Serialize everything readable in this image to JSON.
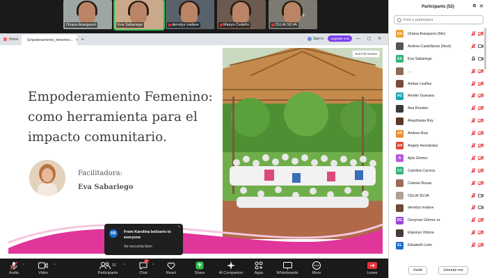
{
  "gallery": {
    "tiles": [
      {
        "name": "Oriana Aranguren",
        "muted": false,
        "active": false,
        "bg": "#9da6a3"
      },
      {
        "name": "Eva Sabariego",
        "muted": false,
        "active": true,
        "bg": "#caa98b"
      },
      {
        "name": "derrelys malave",
        "muted": true,
        "active": false,
        "bg": "#59626b"
      },
      {
        "name": "Mairyn Cedeño",
        "muted": true,
        "active": false,
        "bg": "#6c5a50"
      },
      {
        "name": "CELIA SILVA",
        "muted": true,
        "active": false,
        "bg": "#7d7a72"
      }
    ],
    "next_arrow": "›"
  },
  "browser": {
    "tab_home": "Home",
    "tab_current": "Empoderamiento_femenino...",
    "sign_in": "Sign in",
    "upgrade": "Upgrade now",
    "window_controls": "— ▢ ✕"
  },
  "slide": {
    "title": "Empoderamiento Femenino: como herramienta para el impacto comunitario.",
    "facilitator_label": "Facilitadora:",
    "facilitator_name": "Eva Sabariego",
    "exit_fullscreen": "Exit Full Screen"
  },
  "notification": {
    "initials": "KB",
    "title": "From Karolina belizario to everyone",
    "message": "Se escucha bien",
    "close": "×"
  },
  "toolbar": {
    "audio": "Audio",
    "video": "Video",
    "participants": "Participants",
    "participants_count": "52",
    "chat": "Chat",
    "chat_badge": "1",
    "react": "React",
    "share": "Share",
    "ai_companion": "AI Companion",
    "apps": "Apps",
    "whiteboards": "Whiteboards",
    "more": "More",
    "leave": "Leave",
    "caret": "^",
    "accent_green": "#2fbf4f",
    "leave_red": "#e0333a"
  },
  "panel": {
    "title": "Participants (52)",
    "search_placeholder": "Find a participant",
    "invite": "Invite",
    "unmute_me": "Unmute me",
    "participants": [
      {
        "initials": "OA",
        "color": "#f0a030",
        "name": "Oriana Aranguren (Me)",
        "mic": "muted",
        "cam": "off"
      },
      {
        "initials": "",
        "color": "#555555",
        "name": "Andrea Castellanos (Host)",
        "mic": "muted",
        "cam": "on",
        "photo": true
      },
      {
        "initials": "ES",
        "color": "#2db37a",
        "name": "Eva Sabariego",
        "mic": "on",
        "cam": "on"
      },
      {
        "initials": "",
        "color": "#8a6a5a",
        "name": "....",
        "mic": "muted",
        "cam": "off",
        "photo": true
      },
      {
        "initials": "",
        "color": "#7a4a3a",
        "name": "Ambar Leañez",
        "mic": "muted",
        "cam": "off",
        "photo": true
      },
      {
        "initials": "AG",
        "color": "#1aa6b3",
        "name": "Amelin Guevara",
        "mic": "muted",
        "cam": "off"
      },
      {
        "initials": "",
        "color": "#3a3a3a",
        "name": "Ana Rondón",
        "mic": "muted",
        "cam": "off",
        "photo": true
      },
      {
        "initials": "",
        "color": "#5a3a2a",
        "name": "Anasthasia Rzy",
        "mic": "muted",
        "cam": "off",
        "photo": true
      },
      {
        "initials": "AR",
        "color": "#f08a30",
        "name": "Andrea Ruiz",
        "mic": "muted",
        "cam": "off"
      },
      {
        "initials": "AH",
        "color": "#d94a3a",
        "name": "Angely Hernández",
        "mic": "muted",
        "cam": "off"
      },
      {
        "initials": "A",
        "color": "#b35ad9",
        "name": "Ayla Gómez",
        "mic": "muted",
        "cam": "off"
      },
      {
        "initials": "CC",
        "color": "#2db37a",
        "name": "Carolina Carrera",
        "mic": "muted",
        "cam": "off"
      },
      {
        "initials": "",
        "color": "#a06a5a",
        "name": "Celeste Rosas",
        "mic": "muted",
        "cam": "off",
        "photo": true
      },
      {
        "initials": "",
        "color": "#b0a090",
        "name": "CELIA SILVA",
        "mic": "muted",
        "cam": "on",
        "photo": true
      },
      {
        "initials": "",
        "color": "#6a4a3a",
        "name": "derrelys malave",
        "mic": "muted",
        "cam": "on",
        "photo": true
      },
      {
        "initials": "DG",
        "color": "#9a4ad9",
        "name": "Denymar Gómez vz",
        "mic": "muted",
        "cam": "off"
      },
      {
        "initials": "",
        "color": "#4a3a3a",
        "name": "Eliannys Vidoza",
        "mic": "muted",
        "cam": "off",
        "photo": true
      },
      {
        "initials": "EL",
        "color": "#1a6fd1",
        "name": "Elizabeth León",
        "mic": "muted",
        "cam": "off"
      }
    ]
  }
}
